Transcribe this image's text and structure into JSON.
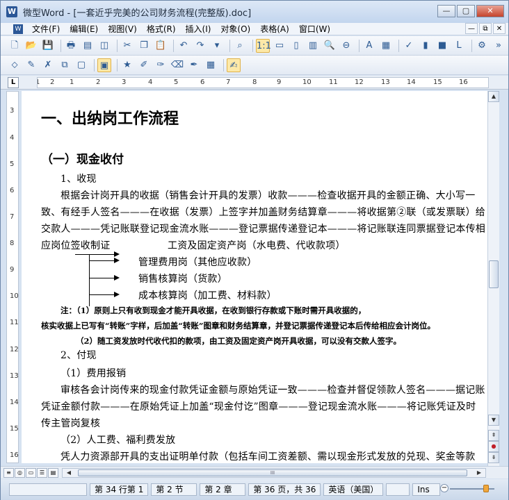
{
  "window": {
    "title": "微型Word - [一套近乎完美的公司财务流程(完整版).doc]",
    "app_icon": "W",
    "minimize_label": "—",
    "maximize_label": "▢",
    "close_label": "✕"
  },
  "menu": {
    "items": [
      "文件(F)",
      "编辑(E)",
      "视图(V)",
      "格式(R)",
      "插入(I)",
      "对象(O)",
      "表格(A)",
      "窗口(W)"
    ],
    "mdi_min": "—",
    "mdi_restore": "⧉",
    "mdi_close": "✕"
  },
  "ruler": {
    "corner": "L",
    "h_numbers": [
      "1",
      "2",
      "1",
      "2",
      "3",
      "4",
      "5",
      "6",
      "7",
      "8",
      "9",
      "10",
      "11",
      "12",
      "13",
      "14",
      "15",
      "16"
    ],
    "v_numbers": [
      "3",
      "4",
      "5",
      "6",
      "7",
      "8",
      "9",
      "10",
      "11",
      "12",
      "13",
      "14",
      "15",
      "16"
    ]
  },
  "document": {
    "heading1": "一、出纳岗工作流程",
    "heading2": "（一）现金收付",
    "lines": [
      "1、收现",
      "根据会计岗开具的收据（销售会计开具的发票）收款———检查收据开具的金额正确、大小写一",
      "致、有经手人签名———在收据（发票）上签字并加盖财务结算章———将收据第②联（或发票联）给",
      "交款人———凭记账联登记现金流水账———登记票据传递登记本———将记账联连同票据登记本传相",
      "应岗位签收制证"
    ],
    "flow_targets": [
      "工资及固定资产岗（水电费、代收款项）",
      "管理费用岗（其他应收款）",
      "销售核算岗（货款）",
      "成本核算岗（加工费、材料款）"
    ],
    "notes": [
      "注：（1）原则上只有收到现金才能开具收据，在收到银行存款或下账时需开具收据的，",
      "核实收据上已写有“转账”字样，后加盖“转账”图章和财务结算章，并登记票据传递登记本后传给相应会计岗位。",
      "（2）随工资发放时代收代扣的款项，由工资及固定资产岗开具收据，可以没有交款人签字。"
    ],
    "pay_lines": [
      "2、付现",
      "（1）费用报销",
      "审核各会计岗传来的现金付款凭证金额与原始凭证一致———检查并督促领款人签名———据记账",
      "凭证金额付款———在原始凭证上加盖“现金付讫”图章———登记现金流水账———将记账凭证及时",
      "传主管岗复核",
      "（2）人工费、福利费发放",
      "凭人力资源部开具的支出证明单付款（包括车间工资差额、需以现金形式发放的兑现、奖金等款"
    ]
  },
  "hscroll_thumb": "III",
  "status": {
    "cells": [
      "第 34 行第 1",
      "第 2 节",
      "第 2 章",
      "第 36 页，共 36",
      "英语（美国）",
      "",
      "Ins"
    ],
    "zoom_minus": "−"
  }
}
